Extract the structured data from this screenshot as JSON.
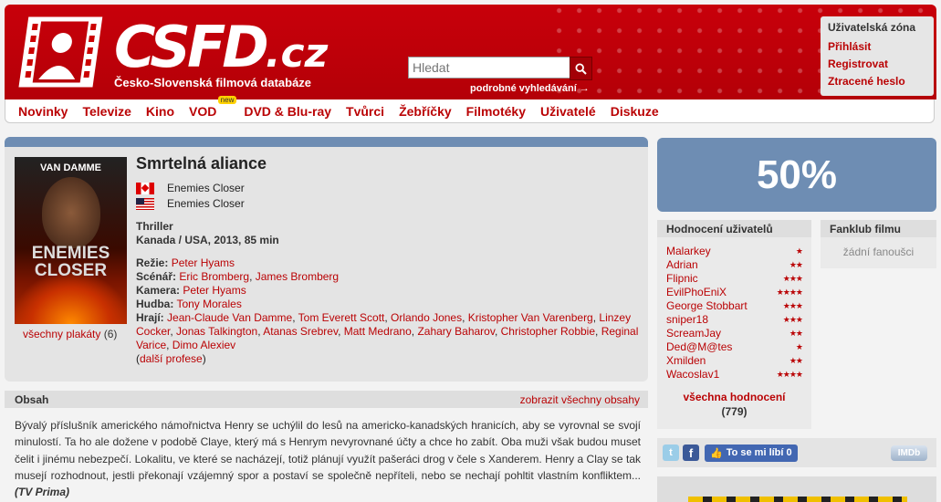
{
  "header": {
    "logo": "CSFD.cz",
    "logo_main": "CSFD",
    "logo_domain": ".cz",
    "subtitle": "Česko-Slovenská filmová databáze",
    "search_placeholder": "Hledat",
    "advanced_search": "podrobné vyhledávání →",
    "user_zone": {
      "title": "Uživatelská zóna",
      "login": "Přihlásit",
      "register": "Registrovat",
      "lost_password": "Ztracené heslo"
    }
  },
  "nav": {
    "items": [
      "Novinky",
      "Televize",
      "Kino",
      "VOD",
      "DVD & Blu-ray",
      "Tvůrci",
      "Žebříčky",
      "Filmotéky",
      "Uživatelé",
      "Diskuze"
    ],
    "vod_badge": "new"
  },
  "film": {
    "title": "Smrtelná aliance",
    "alt_names": [
      {
        "country": "CA",
        "name": "Enemies Closer"
      },
      {
        "country": "US",
        "name": "Enemies Closer"
      }
    ],
    "genre": "Thriller",
    "origin": "Kanada / USA, 2013, 85 min",
    "poster": {
      "top_text": "VAN DAMME",
      "title_line1": "ENEMIES",
      "title_line2": "CLOSER"
    },
    "posters_link": "všechny plakáty",
    "posters_count": "(6)",
    "crew": {
      "director_label": "Režie:",
      "director": "Peter Hyams",
      "writers_label": "Scénář:",
      "writer1": "Eric Bromberg",
      "writer2": "James Bromberg",
      "camera_label": "Kamera:",
      "camera": "Peter Hyams",
      "music_label": "Hudba:",
      "music": "Tony Morales",
      "cast_label": "Hrají:",
      "cast": [
        "Jean-Claude Van Damme",
        "Tom Everett Scott",
        "Orlando Jones",
        "Kristopher Van Varenberg",
        "Linzey Cocker",
        "Jonas Talkington",
        "Atanas Srebrev",
        "Matt Medrano",
        "Zahary Baharov",
        "Christopher Robbie",
        "Reginal Varice",
        "Dimo Alexiev"
      ],
      "more_professions": "další profese"
    }
  },
  "plot": {
    "heading": "Obsah",
    "show_all": "zobrazit všechny obsahy",
    "text": "Bývalý příslušník amerického námořnictva Henry se uchýlil do lesů na americko-kanadských hranicích, aby se vyrovnal se svojí minulostí. Ta ho ale dožene v podobě Claye, který má s Henrym nevyrovnané účty a chce ho zabít. Oba muži však budou muset čelit i jinému nebezpečí. Lokalitu, ve které se nacházejí, totiž plánují využít pašeráci drog v čele s Xanderem. Henry a Clay se tak musejí rozhodnout, jestli překonají vzájemný spor a postaví se společně nepříteli, nebo se nechají pohltit vlastním konfliktem...",
    "source": "(TV Prima)"
  },
  "rating": {
    "percent": "50%",
    "users_heading": "Hodnocení uživatelů",
    "users": [
      {
        "name": "Malarkey",
        "stars": "★"
      },
      {
        "name": "Adrian",
        "stars": "★★"
      },
      {
        "name": "Flipnic",
        "stars": "★★★"
      },
      {
        "name": "EvilPhoEniX",
        "stars": "★★★★"
      },
      {
        "name": "George Stobbart",
        "stars": "★★★"
      },
      {
        "name": "sniper18",
        "stars": "★★★"
      },
      {
        "name": "ScreamJay",
        "stars": "★★"
      },
      {
        "name": "Ded@M@tes",
        "stars": "★"
      },
      {
        "name": "Xmilden",
        "stars": "★★"
      },
      {
        "name": "Wacoslav1",
        "stars": "★★★★"
      }
    ],
    "all_ratings": "všechna hodnocení",
    "count": "(779)"
  },
  "fanclub": {
    "heading": "Fanklub filmu",
    "empty": "žádní fanoušci"
  },
  "social": {
    "like_label": "To se mi líbí 0",
    "imdb": "IMDb"
  },
  "icons": {
    "search": "magnifier-icon",
    "twitter": "twitter-icon",
    "facebook": "facebook-icon"
  }
}
